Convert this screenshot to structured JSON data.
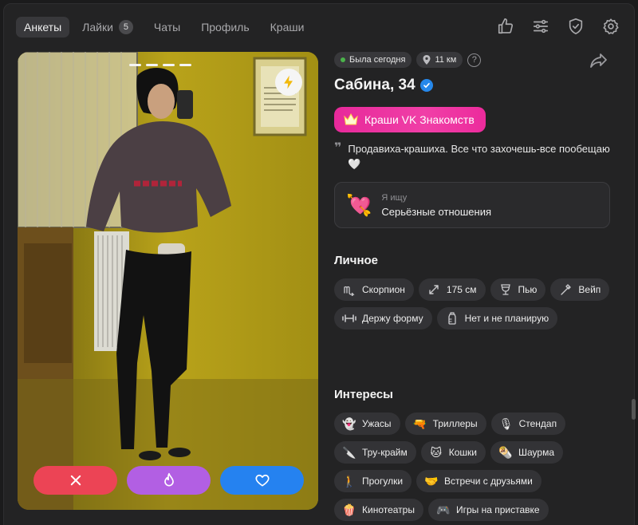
{
  "nav": {
    "tabs": [
      {
        "label": "Анкеты",
        "active": true
      },
      {
        "label": "Лайки",
        "badge": "5"
      },
      {
        "label": "Чаты"
      },
      {
        "label": "Профиль"
      },
      {
        "label": "Краши"
      }
    ],
    "icons": [
      "thumb-up-icon",
      "sliders-icon",
      "shield-check-icon",
      "gear-icon"
    ]
  },
  "profile": {
    "status": "Была сегодня",
    "distance": "11 км",
    "help": "?",
    "name": "Сабина, 34",
    "crush_badge": "Краши VK Знакомств",
    "bio": "Продавиха-крашиха. Все что захочешь-все пообещаю🤍",
    "seeking_label": "Я ищу",
    "seeking_value": "Серьёзные отношения",
    "photo_count": 4
  },
  "personal": {
    "title": "Личное",
    "items": [
      {
        "icon": "scorpio-icon",
        "label": "Скорпион"
      },
      {
        "icon": "height-icon",
        "label": "175 см"
      },
      {
        "icon": "drink-icon",
        "label": "Пью"
      },
      {
        "icon": "vape-icon",
        "label": "Вейп"
      },
      {
        "icon": "dumbbell-icon",
        "label": "Держу форму"
      },
      {
        "icon": "baby-bottle-icon",
        "label": "Нет и не планирую"
      }
    ]
  },
  "interests": {
    "title": "Интересы",
    "items": [
      {
        "icon": "ghost-icon",
        "emoji": "👻",
        "label": "Ужасы"
      },
      {
        "icon": "water-gun-icon",
        "emoji": "🔫",
        "label": "Триллеры"
      },
      {
        "icon": "microphone-icon",
        "emoji": "🎙",
        "label": "Стендап"
      },
      {
        "icon": "knife-icon",
        "emoji": "🔪",
        "label": "Тру-крайм"
      },
      {
        "icon": "cat-icon",
        "emoji": "🐱",
        "label": "Кошки"
      },
      {
        "icon": "burrito-icon",
        "emoji": "🌯",
        "label": "Шаурма"
      },
      {
        "icon": "walking-icon",
        "emoji": "🚶",
        "label": "Прогулки"
      },
      {
        "icon": "handshake-icon",
        "emoji": "🤝",
        "label": "Встречи с друзьями"
      },
      {
        "icon": "popcorn-icon",
        "emoji": "🍿",
        "label": "Кинотеатры"
      },
      {
        "icon": "gamepad-icon",
        "emoji": "🎮",
        "label": "Игры на приставке"
      }
    ]
  },
  "colors": {
    "dislike": "#ec4455",
    "superlike": "#b25fe3",
    "like": "#2582f0",
    "crush": "#ec2b9c",
    "accent": "#2688eb"
  }
}
